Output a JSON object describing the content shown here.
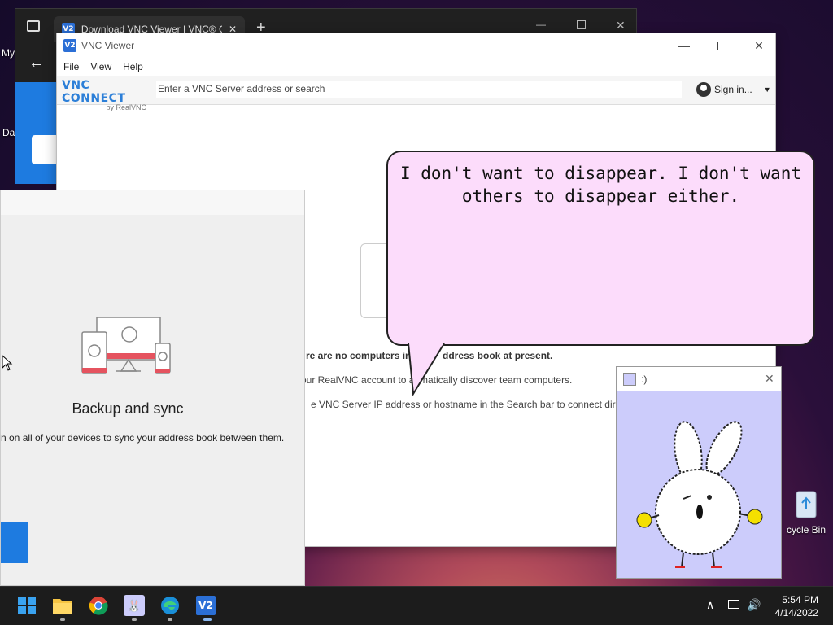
{
  "desktop": {
    "left_label_1": "My",
    "left_label_2": "Da",
    "recycle_bin_label": "cycle Bin"
  },
  "browser": {
    "tab_title": "Download VNC Viewer | VNC® C",
    "back_icon": "arrow-left-icon"
  },
  "vnc_viewer": {
    "title": "VNC Viewer",
    "menu": [
      "File",
      "View",
      "Help"
    ],
    "logo_main": "VNC CONNECT",
    "logo_sub": "by RealVNC",
    "search_placeholder": "Enter a VNC Server address or search",
    "sign_in_label": "Sign in...",
    "messages": [
      "re are no computers in",
      "ddress book at present.",
      "our RealVNC account to a",
      "matically discover team computers.",
      "e VNC Server IP address or hostname in the Search bar to connect directly"
    ],
    "accent_color": "#2c7fd8"
  },
  "backup_panel": {
    "title": "Backup and sync",
    "description": "n on all of your devices to sync your address book between them.",
    "button_color": "#1e7be0"
  },
  "speech_bubble": {
    "text": "I don't want to disappear. I don't want others to disappear either.",
    "background_color": "#fcdcfb"
  },
  "bunny_window": {
    "title": ":)",
    "background_color": "#ccccfb"
  },
  "taskbar": {
    "time": "5:54 PM",
    "date": "4/14/2022",
    "icons": [
      "start-icon",
      "file-explorer-icon",
      "chrome-icon",
      "bunny-app-icon",
      "edge-icon",
      "vnc-viewer-icon"
    ]
  }
}
